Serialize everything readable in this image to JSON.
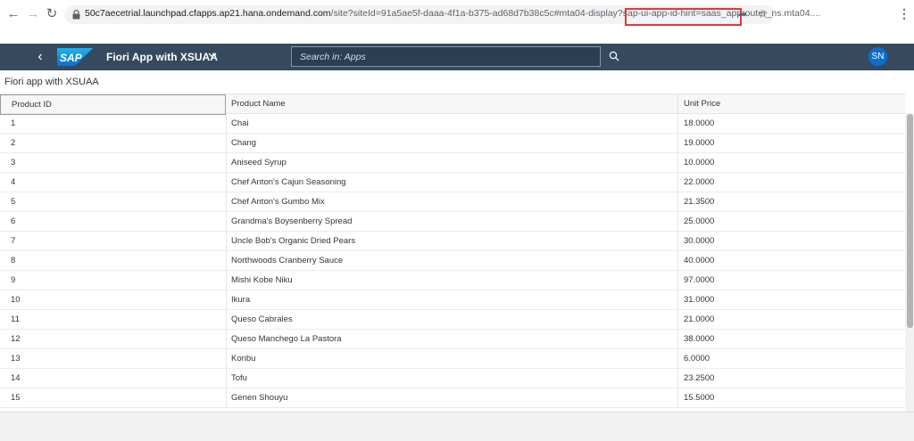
{
  "browser": {
    "url_host": "50c7aecetrial.launchpad.cfapps.ap21.hana.ondemand.com",
    "url_path": "/site?siteId=91a5ae5f-daaa-4f1a-b375-ad68d7b38c5c#mta04-display?sap-ui-app-id-hint=saas_approuter_ns.mta04...."
  },
  "shell": {
    "logo_text": "SAP",
    "app_title": "Fiori App with XSUAA",
    "search_placeholder": "Search in: Apps",
    "avatar_initials": "SN"
  },
  "page": {
    "title": "Fiori app with XSUAA"
  },
  "table": {
    "columns": [
      "Product ID",
      "Product Name",
      "Unit Price"
    ],
    "rows": [
      [
        "1",
        "Chai",
        "18.0000"
      ],
      [
        "2",
        "Chang",
        "19.0000"
      ],
      [
        "3",
        "Aniseed Syrup",
        "10.0000"
      ],
      [
        "4",
        "Chef Anton's Cajun Seasoning",
        "22.0000"
      ],
      [
        "5",
        "Chef Anton's Gumbo Mix",
        "21.3500"
      ],
      [
        "6",
        "Grandma's Boysenberry Spread",
        "25.0000"
      ],
      [
        "7",
        "Uncle Bob's Organic Dried Pears",
        "30.0000"
      ],
      [
        "8",
        "Northwoods Cranberry Sauce",
        "40.0000"
      ],
      [
        "9",
        "Mishi Kobe Niku",
        "97.0000"
      ],
      [
        "10",
        "Ikura",
        "31.0000"
      ],
      [
        "11",
        "Queso Cabrales",
        "21.0000"
      ],
      [
        "12",
        "Queso Manchego La Pastora",
        "38.0000"
      ],
      [
        "13",
        "Konbu",
        "6.0000"
      ],
      [
        "14",
        "Tofu",
        "23.2500"
      ],
      [
        "15",
        "Genen Shouyu",
        "15.5000"
      ]
    ]
  },
  "colors": {
    "shell_bg": "#354a5f",
    "accent": "#0a6ed1",
    "highlight_box": "#e0393e"
  }
}
